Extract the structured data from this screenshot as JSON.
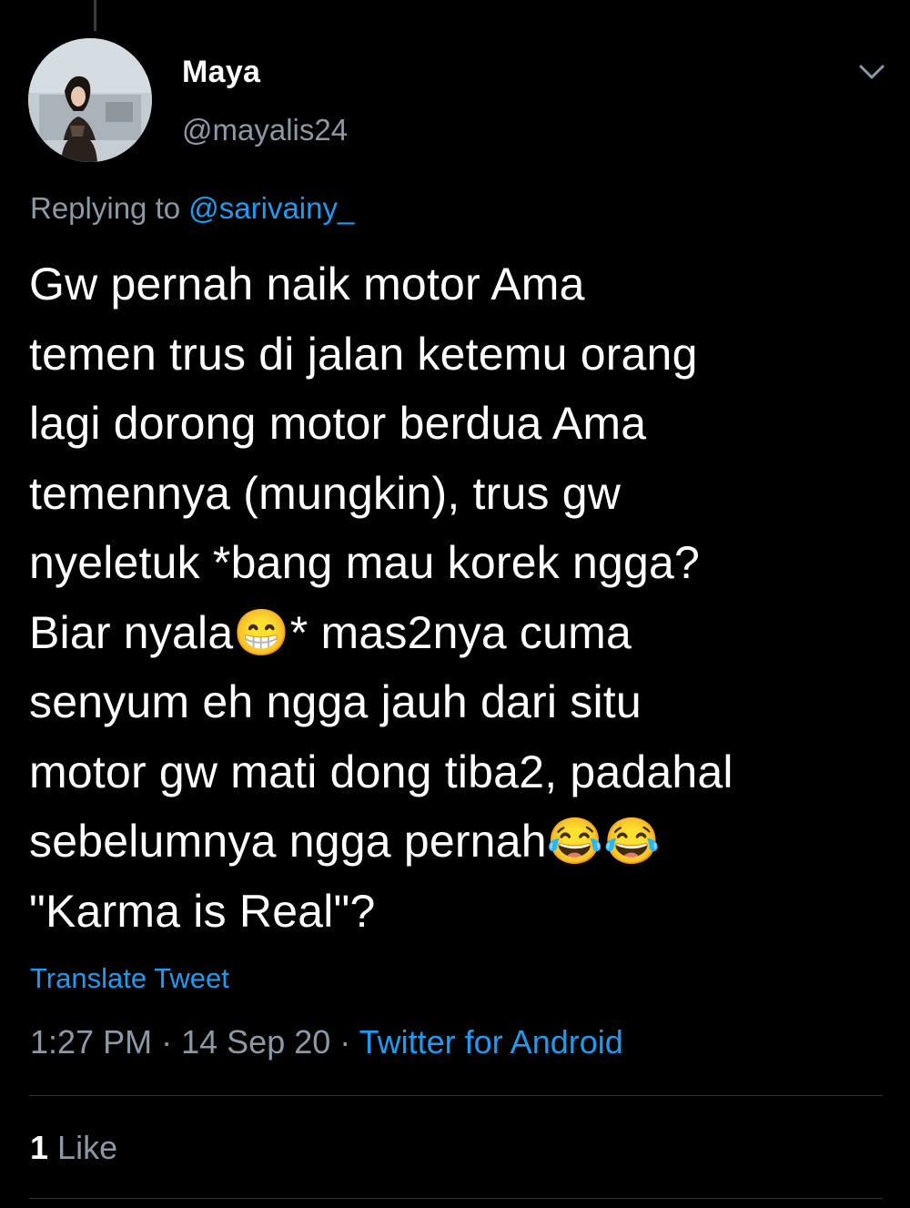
{
  "tweet": {
    "display_name": "Maya",
    "handle": "@mayalis24",
    "replying_prefix": "Replying to",
    "replying_to": "@sarivainy_",
    "text_lines": [
      "Gw pernah naik motor Ama",
      "temen trus di jalan ketemu orang",
      "lagi dorong motor berdua Ama",
      "temennya (mungkin), trus gw",
      "nyeletuk *bang mau korek ngga?",
      "Biar nyala😁* mas2nya cuma",
      "senyum eh ngga jauh dari situ",
      "motor gw mati dong tiba2, padahal",
      "sebelumnya ngga pernah😂😂",
      "\"Karma is Real\"?"
    ],
    "translate_label": "Translate Tweet",
    "time": "1:27 PM",
    "date": "14 Sep 20",
    "separator": "·",
    "source": "Twitter for Android",
    "like_count": "1",
    "like_label": "Like"
  },
  "icons": {
    "more": "chevron-down-icon"
  },
  "colors": {
    "background": "#000000",
    "text": "#ffffff",
    "secondary": "#8b98a5",
    "accent": "#1d9bf0",
    "divider": "#2f3336"
  }
}
